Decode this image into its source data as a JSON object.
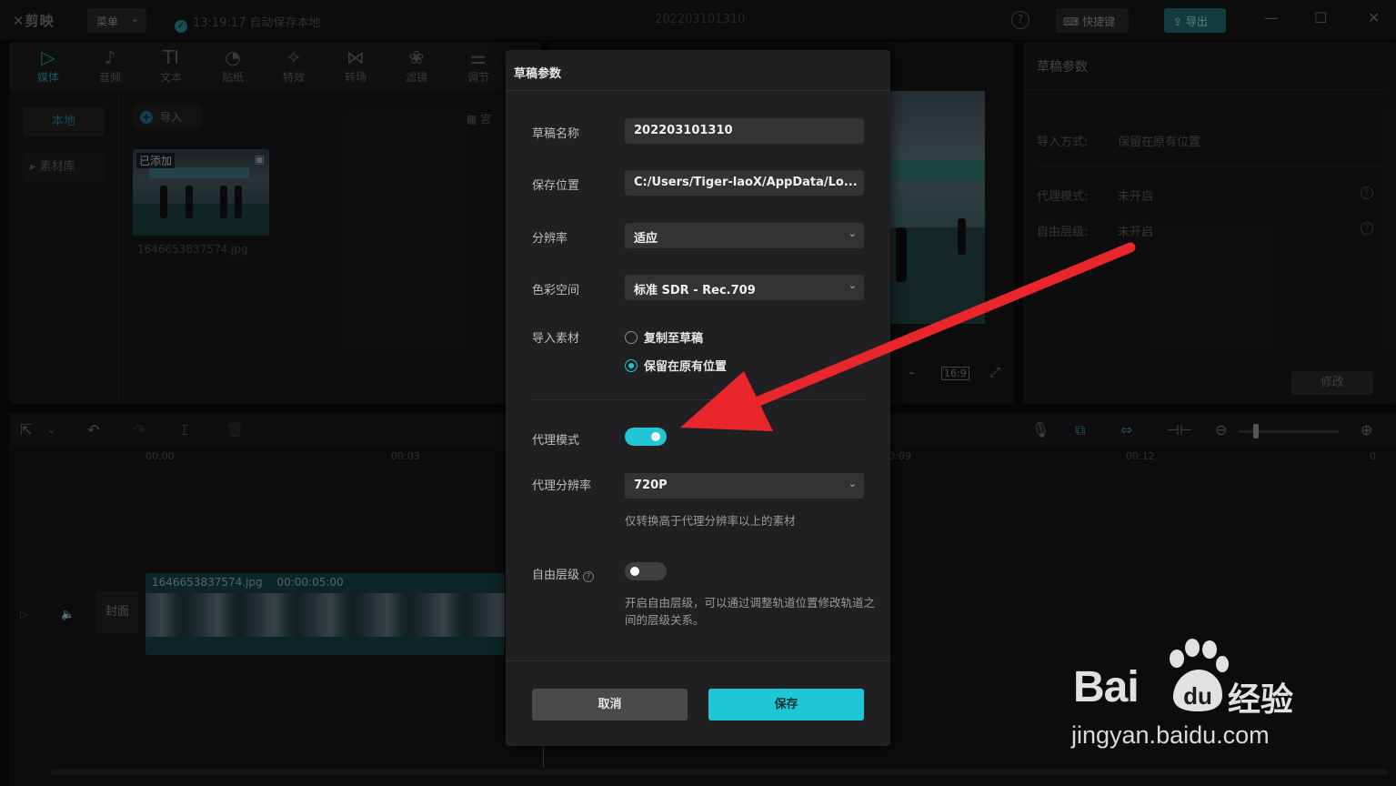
{
  "titlebar": {
    "app_name": "剪映",
    "menu_label": "菜单",
    "autosave_text": "13:19:17 自动保存本地",
    "document_title": "202203101310",
    "shortcut_label": "快捷键",
    "export_label": "导出"
  },
  "media_tabs": [
    {
      "label": "媒体",
      "icon": "▷"
    },
    {
      "label": "音频",
      "icon": "♪"
    },
    {
      "label": "文本",
      "icon": "TI"
    },
    {
      "label": "贴纸",
      "icon": "◔"
    },
    {
      "label": "特效",
      "icon": "✧"
    },
    {
      "label": "转场",
      "icon": "⋈"
    },
    {
      "label": "滤镜",
      "icon": "❀"
    },
    {
      "label": "调节",
      "icon": "⚌"
    }
  ],
  "media_side": {
    "local_label": "本地",
    "library_label": "素材库"
  },
  "media": {
    "import_label": "导入",
    "view_label": "宫",
    "thumb_badge": "已添加",
    "thumb_filename": "1646653837574.jpg"
  },
  "preview": {
    "ratio_label": "16:9"
  },
  "props": {
    "title": "草稿参数",
    "import_mode_label": "导入方式:",
    "import_mode_value": "保留在原有位置",
    "proxy_label": "代理模式:",
    "proxy_value": "未开启",
    "layer_label": "自由层级:",
    "layer_value": "未开启",
    "modify_label": "修改"
  },
  "timeline": {
    "ticks": [
      "00:00",
      "00:03",
      "00:09",
      "00:12",
      "0"
    ],
    "cover_label": "封面",
    "clip_name": "1646653837574.jpg",
    "clip_duration": "00:00:05:00"
  },
  "dialog": {
    "title": "草稿参数",
    "name_label": "草稿名称",
    "name_value": "202203101310",
    "path_label": "保存位置",
    "path_value": "C:/Users/Tiger-laoX/AppData/Lo...",
    "resolution_label": "分辨率",
    "resolution_value": "适应",
    "colorspace_label": "色彩空间",
    "colorspace_value": "标准 SDR - Rec.709",
    "import_label": "导入素材",
    "import_options": [
      "复制至草稿",
      "保留在原有位置"
    ],
    "proxy_mode_label": "代理模式",
    "proxy_res_label": "代理分辨率",
    "proxy_res_value": "720P",
    "proxy_hint": "仅转换高于代理分辨率以上的素材",
    "free_layer_label": "自由层级",
    "free_layer_hint": "开启自由层级，可以通过调整轨道位置修改轨道之间的层级关系。",
    "cancel_label": "取消",
    "save_label": "保存"
  },
  "watermark": {
    "brand_latin": "Bai",
    "brand_du": "du",
    "brand_cn": "经验",
    "url": "jingyan.baidu.com"
  },
  "colors": {
    "accent": "#1fc6d6",
    "arrow": "#e8262b",
    "dialog_bg": "#202022"
  }
}
